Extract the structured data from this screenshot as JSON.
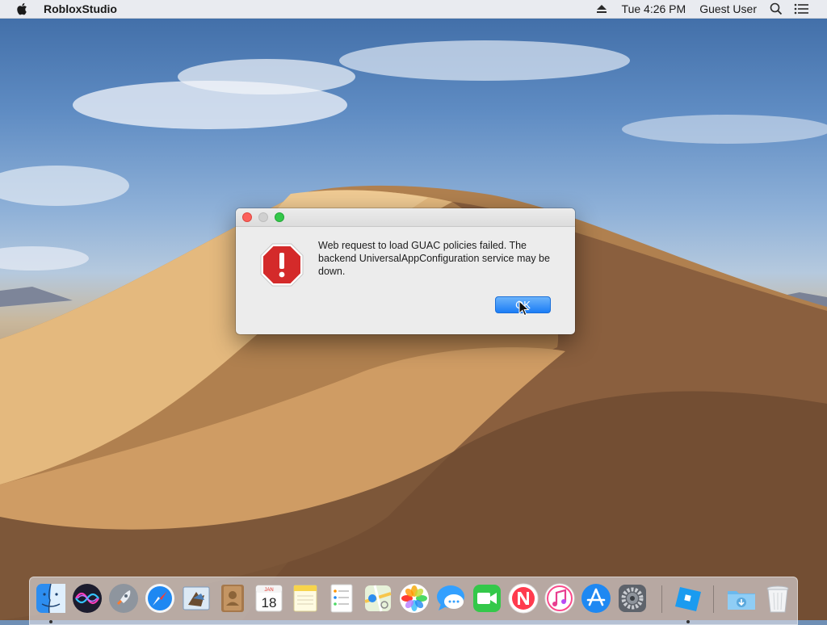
{
  "menubar": {
    "app_name": "RobloxStudio",
    "clock": "Tue 4:26 PM",
    "user": "Guest User"
  },
  "alert": {
    "message": "Web request to load GUAC policies failed. The backend UniversalAppConfiguration service may be down.",
    "ok_label": "OK"
  },
  "dock": {
    "calendar_month": "JAN",
    "calendar_day": "18",
    "items": [
      "finder-icon",
      "siri-icon",
      "launchpad-icon",
      "safari-icon",
      "mail-icon",
      "contacts-icon",
      "calendar-icon",
      "notes-icon",
      "reminders-icon",
      "maps-icon",
      "photos-icon",
      "messages-icon",
      "facetime-icon",
      "news-icon",
      "itunes-icon",
      "app-store-icon",
      "system-preferences-icon",
      "roblox-studio-icon",
      "downloads-icon",
      "trash-icon"
    ]
  },
  "colors": {
    "accent_blue": "#1b7df6",
    "close_red": "#fc605b",
    "zoom_green": "#34c84a",
    "stop_red": "#d42a2a"
  }
}
